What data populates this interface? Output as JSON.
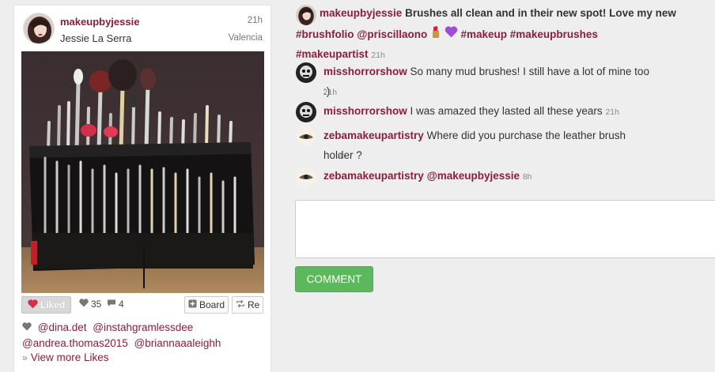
{
  "post": {
    "username": "makeupbyjessie",
    "fullname": "Jessie La Serra",
    "time": "21h",
    "location": "Valencia"
  },
  "actions": {
    "liked_label": "Liked",
    "likes_count": "35",
    "comments_count": "4",
    "board_label": "Board",
    "regram_label": "Re"
  },
  "likes": {
    "users": [
      "@dina.det",
      "@instahgramlessdee",
      "@andrea.thomas2015",
      "@briannaaaleighh"
    ],
    "view_more": "View more Likes"
  },
  "caption": {
    "username": "makeupbyjessie",
    "text1": "Brushes all clean and in their new spot! Love my new",
    "tag1": "#brushfolio",
    "tag2": "@priscillaono",
    "tag3": "#makeup",
    "tag4": "#makeupbrushes",
    "tag5": "#makeupartist",
    "time": "21h"
  },
  "comments": [
    {
      "username": "misshorrorshow",
      "text": "So many mud brushes! I still have a lot of mine too :)",
      "time": "21h"
    },
    {
      "username": "misshorrorshow",
      "text": "I was amazed they lasted all these years",
      "time": "21h"
    },
    {
      "username": "zebamakeupartistry",
      "text": "Where did you purchase the leather brush holder ?",
      "time": "8h"
    },
    {
      "username": "zebamakeupartistry",
      "text": "@makeupbyjessie",
      "time": "8h"
    }
  ],
  "comment_form": {
    "placeholder": "",
    "button_label": "COMMENT"
  },
  "colors": {
    "username": "#8a1e3c",
    "comment_button": "#5cb85c",
    "liked_heart": "#c9334d"
  }
}
